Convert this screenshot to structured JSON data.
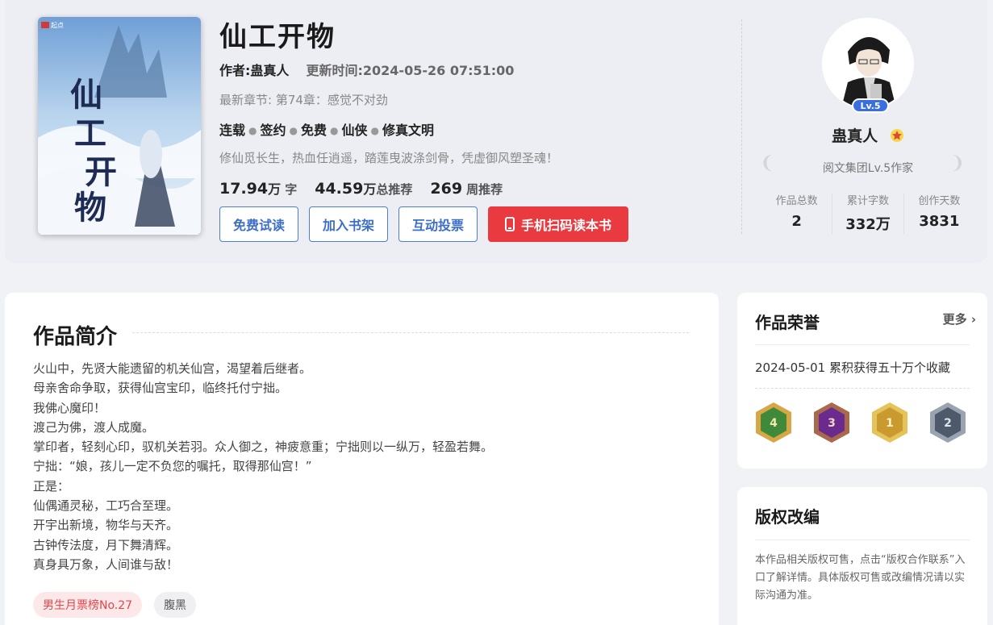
{
  "book": {
    "title": "仙工开物",
    "author_label": "作者:蛊真人",
    "updated_label": "更新时间:2024-05-26 07:51:00",
    "latest_chapter": "最新章节: 第74章：感觉不对劲",
    "tags": [
      "连载",
      "签约",
      "免费",
      "仙侠",
      "修真文明"
    ],
    "tagline": "修仙觅长生，热血任逍遥，踏莲曳波涤剑骨，凭虚御风塑圣魂！",
    "cover_publisher": "起点",
    "stats": [
      {
        "num": "17.94",
        "unit": "万",
        "label": "字"
      },
      {
        "num": "44.59",
        "unit": "万",
        "label": "总推荐"
      },
      {
        "num": "269",
        "unit": "",
        "label": "周推荐"
      }
    ]
  },
  "buttons": {
    "free_read": "免费试读",
    "add_shelf": "加入书架",
    "vote": "互动投票",
    "mobile_scan": "手机扫码读本书"
  },
  "author": {
    "level_badge": "Lv.5",
    "name": "蛊真人",
    "title": "阅文集团Lv.5作家",
    "stats": [
      {
        "label": "作品总数",
        "value": "2"
      },
      {
        "label": "累计字数",
        "value": "332万"
      },
      {
        "label": "创作天数",
        "value": "3831"
      }
    ]
  },
  "synopsis": {
    "heading": "作品简介",
    "lines": [
      "火山中，先贤大能遗留的机关仙宫，渴望着后继者。",
      "母亲舍命争取，获得仙宫宝印，临终托付宁拙。",
      "我佛心魔印！",
      "渡己为佛，渡人成魔。",
      "掌印者，轻刻心印，驭机关若羽。众人御之，神疲意重；宁拙则以一纵万，轻盈若舞。",
      "宁拙：“娘，孩儿一定不负您的嘱托，取得那仙宫！”",
      "正是：",
      "仙偶通灵秘，工巧合至理。",
      "开宇出新境，物华与天齐。",
      "古钟传法度，月下舞清辉。",
      "真身具万象，人间谁与敌！"
    ],
    "chips": [
      "男生月票榜No.27",
      "腹黑"
    ]
  },
  "honors": {
    "heading": "作品荣誉",
    "more": "更多",
    "items": [
      "2024-05-01 累积获得五十万个收藏"
    ],
    "medals": [
      {
        "label": "4",
        "color": "#3f8a3a",
        "rim": "#d9a646"
      },
      {
        "label": "3",
        "color": "#6b2a8e",
        "rim": "#a86a4a"
      },
      {
        "label": "1",
        "color": "#c99a2e",
        "rim": "#e6c35a"
      },
      {
        "label": "2",
        "color": "#4e5a6b",
        "rim": "#9aa3b0"
      }
    ]
  },
  "copyright": {
    "heading": "版权改编",
    "text": "本作品相关版权可售，点击“版权合作联系”入口了解详情。具体版权可售或改编情况请以实际沟通为准。"
  }
}
